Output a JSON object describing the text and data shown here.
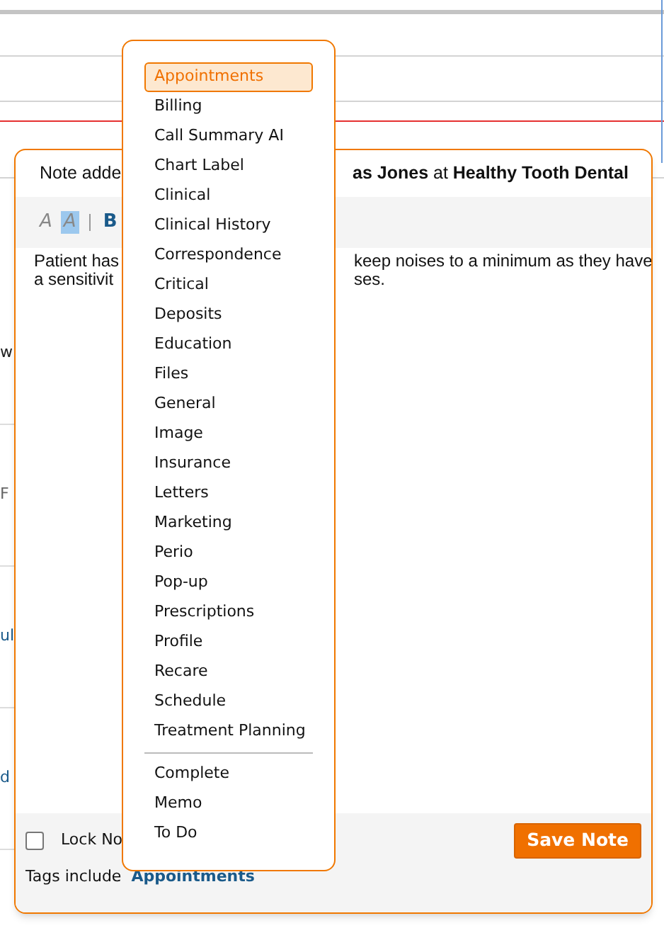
{
  "background": {
    "row_fragments": [
      {
        "text": "w",
        "kind": "plain"
      },
      {
        "text": "F",
        "kind": "muted"
      },
      {
        "text": "ul",
        "kind": "link"
      },
      {
        "text": "d",
        "kind": "link"
      }
    ]
  },
  "note_dialog": {
    "header_left": "Note adde",
    "header_right": "**as Jones** at **Healthy Tooth Dental**",
    "toolbar": [
      {
        "label": "A",
        "kind": "italic",
        "selected": false
      },
      {
        "label": "A",
        "kind": "italic",
        "selected": true
      },
      {
        "label": "B",
        "kind": "bold",
        "selected": false
      }
    ],
    "body_left": [
      "Patient has",
      "a sensitivit"
    ],
    "body_right": [
      "keep noises to a minimum as they have",
      "ses."
    ],
    "lock_checkbox": {
      "label": "Lock No",
      "checked": false
    },
    "save_button": "Save Note",
    "tags_label": "Tags include",
    "tags_value": "Appointments"
  },
  "tag_dropdown": {
    "groups": [
      [
        {
          "label": "Appointments",
          "selected": true
        },
        {
          "label": "Billing",
          "selected": false
        },
        {
          "label": "Call Summary AI",
          "selected": false
        },
        {
          "label": "Chart Label",
          "selected": false
        },
        {
          "label": "Clinical",
          "selected": false
        },
        {
          "label": "Clinical History",
          "selected": false
        },
        {
          "label": "Correspondence",
          "selected": false
        },
        {
          "label": "Critical",
          "selected": false
        },
        {
          "label": "Deposits",
          "selected": false
        },
        {
          "label": "Education",
          "selected": false
        },
        {
          "label": "Files",
          "selected": false
        },
        {
          "label": "General",
          "selected": false
        },
        {
          "label": "Image",
          "selected": false
        },
        {
          "label": "Insurance",
          "selected": false
        },
        {
          "label": "Letters",
          "selected": false
        },
        {
          "label": "Marketing",
          "selected": false
        },
        {
          "label": "Perio",
          "selected": false
        },
        {
          "label": "Pop-up",
          "selected": false
        },
        {
          "label": "Prescriptions",
          "selected": false
        },
        {
          "label": "Profile",
          "selected": false
        },
        {
          "label": "Recare",
          "selected": false
        },
        {
          "label": "Schedule",
          "selected": false
        },
        {
          "label": "Treatment Planning",
          "selected": false
        }
      ],
      [
        {
          "label": "Complete",
          "selected": false
        },
        {
          "label": "Memo",
          "selected": false
        },
        {
          "label": "To Do",
          "selected": false
        }
      ]
    ]
  }
}
